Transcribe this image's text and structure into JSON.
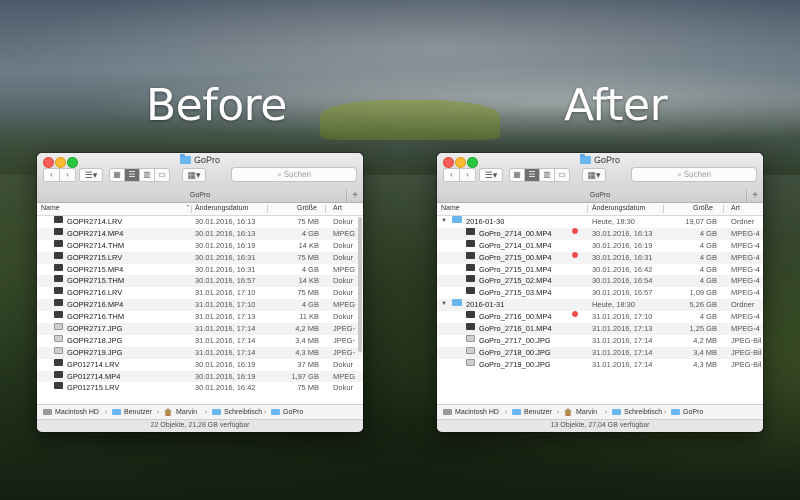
{
  "labels": {
    "before": "Before",
    "after": "After"
  },
  "colors": {
    "tag_red": "#ef4b48",
    "folder_blue": "#6ab7f0",
    "active_segment": "#6e6e6e"
  },
  "left": {
    "title": "GoPro",
    "search_placeholder": "Suchen",
    "tab_label": "GoPro",
    "columns": {
      "name": "Name",
      "date": "Änderungsdatum",
      "size": "Größe",
      "kind": "Art"
    },
    "rows": [
      {
        "name": "GOPR2714.LRV",
        "date": "30.01.2016, 16:13",
        "size": "75 MB",
        "kind": "Dokur",
        "icon": "video-file-icon"
      },
      {
        "name": "GOPR2714.MP4",
        "date": "30.01.2016, 16:13",
        "size": "4 GB",
        "kind": "MPEG",
        "icon": "video-file-icon"
      },
      {
        "name": "GOPR2714.THM",
        "date": "30.01.2016, 16:19",
        "size": "14 KB",
        "kind": "Dokur",
        "icon": "video-file-icon"
      },
      {
        "name": "GOPR2715.LRV",
        "date": "30.01.2016, 16:31",
        "size": "75 MB",
        "kind": "Dokur",
        "icon": "video-file-icon"
      },
      {
        "name": "GOPR2715.MP4",
        "date": "30.01.2016, 16:31",
        "size": "4 GB",
        "kind": "MPEG",
        "icon": "video-file-icon"
      },
      {
        "name": "GOPR2715.THM",
        "date": "30.01.2016, 16:57",
        "size": "14 KB",
        "kind": "Dokur",
        "icon": "video-file-icon"
      },
      {
        "name": "GOPR2716.LRV",
        "date": "31.01.2016, 17:10",
        "size": "75 MB",
        "kind": "Dokur",
        "icon": "video-file-icon"
      },
      {
        "name": "GOPR2716.MP4",
        "date": "31.01.2016, 17:10",
        "size": "4 GB",
        "kind": "MPEG",
        "icon": "video-file-icon"
      },
      {
        "name": "GOPR2716.THM",
        "date": "31.01.2016, 17:13",
        "size": "11 KB",
        "kind": "Dokur",
        "icon": "video-file-icon"
      },
      {
        "name": "GOPR2717.JPG",
        "date": "31.01.2016, 17:14",
        "size": "4,2 MB",
        "kind": "JPEG-",
        "icon": "image-file-icon"
      },
      {
        "name": "GOPR2718.JPG",
        "date": "31.01.2016, 17:14",
        "size": "3,4 MB",
        "kind": "JPEG-",
        "icon": "image-file-icon"
      },
      {
        "name": "GOPR2719.JPG",
        "date": "31.01.2016, 17:14",
        "size": "4,3 MB",
        "kind": "JPEG-",
        "icon": "image-file-icon"
      },
      {
        "name": "GP012714.LRV",
        "date": "30.01.2016, 16:19",
        "size": "37 MB",
        "kind": "Dokur",
        "icon": "video-file-icon"
      },
      {
        "name": "GP012714.MP4",
        "date": "30.01.2016, 16:19",
        "size": "1,97 GB",
        "kind": "MPEG",
        "icon": "video-file-icon"
      },
      {
        "name": "GP012715.LRV",
        "date": "30.01.2016, 16:42",
        "size": "75 MB",
        "kind": "Dokur",
        "icon": "video-file-icon"
      }
    ],
    "path": [
      "Macintosh HD",
      "Benutzer",
      "Marvin",
      "Schreibtisch",
      "GoPro"
    ],
    "status": "22 Objekte, 21,28 GB verfügbar"
  },
  "right": {
    "title": "GoPro",
    "search_placeholder": "Suchen",
    "tab_label": "GoPro",
    "columns": {
      "name": "Name",
      "date": "Änderungsdatum",
      "size": "Größe",
      "kind": "Art"
    },
    "rows": [
      {
        "type": "folder",
        "name": "2016-01-30",
        "date": "Heute, 18:30",
        "size": "19,07 GB",
        "kind": "Ordner",
        "tag": false
      },
      {
        "type": "file",
        "name": "GoPro_2714_00.MP4",
        "date": "30.01.2016, 16:13",
        "size": "4 GB",
        "kind": "MPEG-4",
        "tag": true,
        "icon": "video-file-icon"
      },
      {
        "type": "file",
        "name": "GoPro_2714_01.MP4",
        "date": "30.01.2016, 16:19",
        "size": "4 GB",
        "kind": "MPEG-4",
        "tag": false,
        "icon": "video-file-icon"
      },
      {
        "type": "file",
        "name": "GoPro_2715_00.MP4",
        "date": "30.01.2016, 16:31",
        "size": "4 GB",
        "kind": "MPEG-4",
        "tag": true,
        "icon": "video-file-icon"
      },
      {
        "type": "file",
        "name": "GoPro_2715_01.MP4",
        "date": "30.01.2016, 16:42",
        "size": "4 GB",
        "kind": "MPEG-4",
        "tag": false,
        "icon": "video-file-icon"
      },
      {
        "type": "file",
        "name": "GoPro_2715_02.MP4",
        "date": "30.01.2016, 16:54",
        "size": "4 GB",
        "kind": "MPEG-4",
        "tag": false,
        "icon": "video-file-icon"
      },
      {
        "type": "file",
        "name": "GoPro_2715_03.MP4",
        "date": "30.01.2016, 16:57",
        "size": "1,09 GB",
        "kind": "MPEG-4",
        "tag": false,
        "icon": "video-file-icon"
      },
      {
        "type": "folder",
        "name": "2016-01-31",
        "date": "Heute, 18:30",
        "size": "5,26 GB",
        "kind": "Ordner",
        "tag": false
      },
      {
        "type": "file",
        "name": "GoPro_2716_00.MP4",
        "date": "31.01.2016, 17:10",
        "size": "4 GB",
        "kind": "MPEG-4",
        "tag": true,
        "icon": "video-file-icon"
      },
      {
        "type": "file",
        "name": "GoPro_2716_01.MP4",
        "date": "31.01.2016, 17:13",
        "size": "1,25 GB",
        "kind": "MPEG-4",
        "tag": false,
        "icon": "video-file-icon"
      },
      {
        "type": "file",
        "name": "GoPro_2717_00.JPG",
        "date": "31.01.2016, 17:14",
        "size": "4,2 MB",
        "kind": "JPEG-Bil",
        "tag": false,
        "icon": "image-file-icon"
      },
      {
        "type": "file",
        "name": "GoPro_2718_00.JPG",
        "date": "31.01.2016, 17:14",
        "size": "3,4 MB",
        "kind": "JPEG-Bil",
        "tag": false,
        "icon": "image-file-icon"
      },
      {
        "type": "file",
        "name": "GoPro_2719_00.JPG",
        "date": "31.01.2016, 17:14",
        "size": "4,3 MB",
        "kind": "JPEG-Bil",
        "tag": false,
        "icon": "image-file-icon"
      }
    ],
    "path": [
      "Macintosh HD",
      "Benutzer",
      "Marvin",
      "Schreibtisch",
      "GoPro"
    ],
    "status": "13 Objekte, 27,04 GB verfügbar"
  }
}
